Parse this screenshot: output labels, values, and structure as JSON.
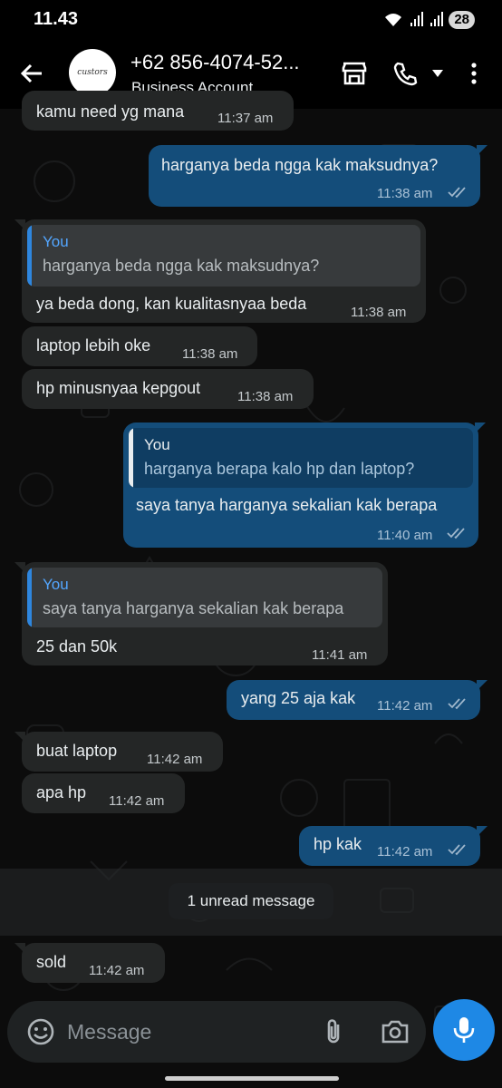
{
  "status": {
    "time": "11.43",
    "battery": "28"
  },
  "header": {
    "contact_name": "+62 856-4074-52...",
    "subtitle": "Business Account",
    "avatar_text": "custors"
  },
  "messages": [
    {
      "dir": "in",
      "text": "kamu need yg mana",
      "time": "11:37 am"
    },
    {
      "dir": "out",
      "text": "harganya beda ngga kak maksudnya?",
      "time": "11:38 am"
    },
    {
      "dir": "in",
      "quote_author": "You",
      "quote_text": "harganya beda ngga kak maksudnya?",
      "text": "ya beda dong, kan kualitasnyaa beda",
      "time": "11:38 am"
    },
    {
      "dir": "in",
      "text": "laptop lebih oke",
      "time": "11:38 am"
    },
    {
      "dir": "in",
      "text": "hp minusnyaa kepgout",
      "time": "11:38 am"
    },
    {
      "dir": "out",
      "quote_author": "You",
      "quote_text": "harganya berapa kalo hp dan laptop?",
      "text": "saya tanya harganya sekalian kak berapa",
      "time": "11:40 am"
    },
    {
      "dir": "in",
      "quote_author": "You",
      "quote_text": "saya tanya harganya sekalian kak berapa",
      "text": "25 dan 50k",
      "time": "11:41 am"
    },
    {
      "dir": "out",
      "text": "yang 25 aja kak",
      "time": "11:42 am"
    },
    {
      "dir": "in",
      "text": "buat laptop",
      "time": "11:42 am"
    },
    {
      "dir": "in",
      "text": "apa hp",
      "time": "11:42 am"
    },
    {
      "dir": "out",
      "text": "hp kak",
      "time": "11:42 am"
    },
    {
      "dir": "in",
      "text": "sold",
      "time": "11:42 am"
    }
  ],
  "unread": {
    "label": "1 unread message"
  },
  "composer": {
    "placeholder": "Message"
  },
  "colors": {
    "incoming_bubble": "#242626",
    "outgoing_bubble": "#144d7a",
    "accent": "#1e88e5",
    "read_ticks": "#9fb7cc"
  },
  "icons": [
    "back-arrow-icon",
    "store-icon",
    "phone-icon",
    "chevron-down-icon",
    "more-vert-icon",
    "emoji-icon",
    "paperclip-icon",
    "camera-icon",
    "mic-icon",
    "double-check-icon"
  ]
}
